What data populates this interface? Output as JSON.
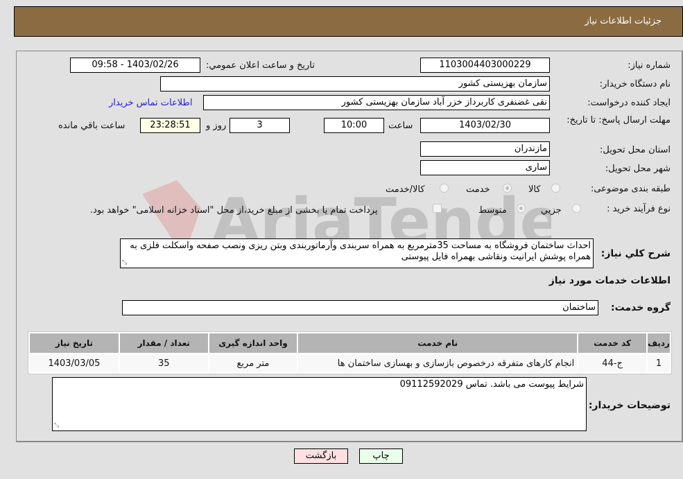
{
  "header": {
    "title": "جزئیات اطلاعات نیاز"
  },
  "form": {
    "need_number": {
      "label": "شماره نیاز:",
      "value": "1103004403000229"
    },
    "announce_datetime": {
      "label": "تاریخ و ساعت اعلان عمومي:",
      "value": "1403/02/26 - 09:58"
    },
    "buyer_org": {
      "label": "نام دستگاه خریدار:",
      "value": "سازمان بهزیستی کشور"
    },
    "requester": {
      "label": "ایجاد کننده درخواست:",
      "value": "نقی غضنفری کاربرداز خزر آباد سازمان بهزیستی کشور"
    },
    "buyer_contact_link": "اطلاعات تماس خریدار",
    "deadline": {
      "label": "مهلت ارسال پاسخ: تا تاریخ:",
      "date": "1403/02/30",
      "time_label": "ساعت",
      "time": "10:00",
      "days": "3",
      "days_label": "روز و",
      "remaining": "23:28:51",
      "remaining_label": "ساعت باقي مانده"
    },
    "province": {
      "label": "استان محل تحویل:",
      "value": "مازندران"
    },
    "city": {
      "label": "شهر محل تحویل:",
      "value": "ساری"
    },
    "category": {
      "label": "طبقه بندی موضوعی:",
      "options": [
        {
          "label": "کالا",
          "checked": false
        },
        {
          "label": "خدمت",
          "checked": true
        },
        {
          "label": "کالا/خدمت",
          "checked": false
        }
      ]
    },
    "purchase_type": {
      "label": "نوع فرآیند خرید :",
      "options": [
        {
          "label": "جزيي",
          "checked": false
        },
        {
          "label": "متوسط",
          "checked": true
        }
      ],
      "payment_note": "پرداخت تمام یا بخشی از مبلغ خرید،از محل \"اسناد خزانه اسلامی\" خواهد بود.",
      "payment_checked": false
    },
    "description": {
      "label": "شرح کلي نیاز:",
      "value": "احداث ساختمان فروشگاه به مساحت 35مترمربع به همراه سربندی وآرماتوربندی وبتن ریزی ونصب صفحه واسکلت فلزی به همراه پوشش ایرانیت ونقاشی بهمراه فایل پیوستی"
    }
  },
  "services": {
    "section_title": "اطلاعات خدمات مورد نیاز",
    "group_label": "گروه خدمت:",
    "group_value": "ساختمان",
    "table": {
      "headers": [
        "ردیف",
        "کد خدمت",
        "نام خدمت",
        "واحد اندازه گیری",
        "تعداد / مقدار",
        "تاریخ نیاز"
      ],
      "rows": [
        [
          "1",
          "ج-44",
          "انجام کارهای متفرقه درخصوص بازسازی و بهسازی ساختمان ها",
          "متر مربع",
          "35",
          "1403/03/05"
        ]
      ]
    }
  },
  "buyer_notes": {
    "label": "توضیحات خریدار:",
    "value": "شرایط پیوست می باشد. تماس 09112592029"
  },
  "buttons": {
    "print": "چاپ",
    "back": "بازگشت"
  },
  "colors": {
    "header_bg": "#8b6c42",
    "print_bg": "#eaffea",
    "back_bg": "#ffe0e0",
    "link": "#2222cc"
  }
}
